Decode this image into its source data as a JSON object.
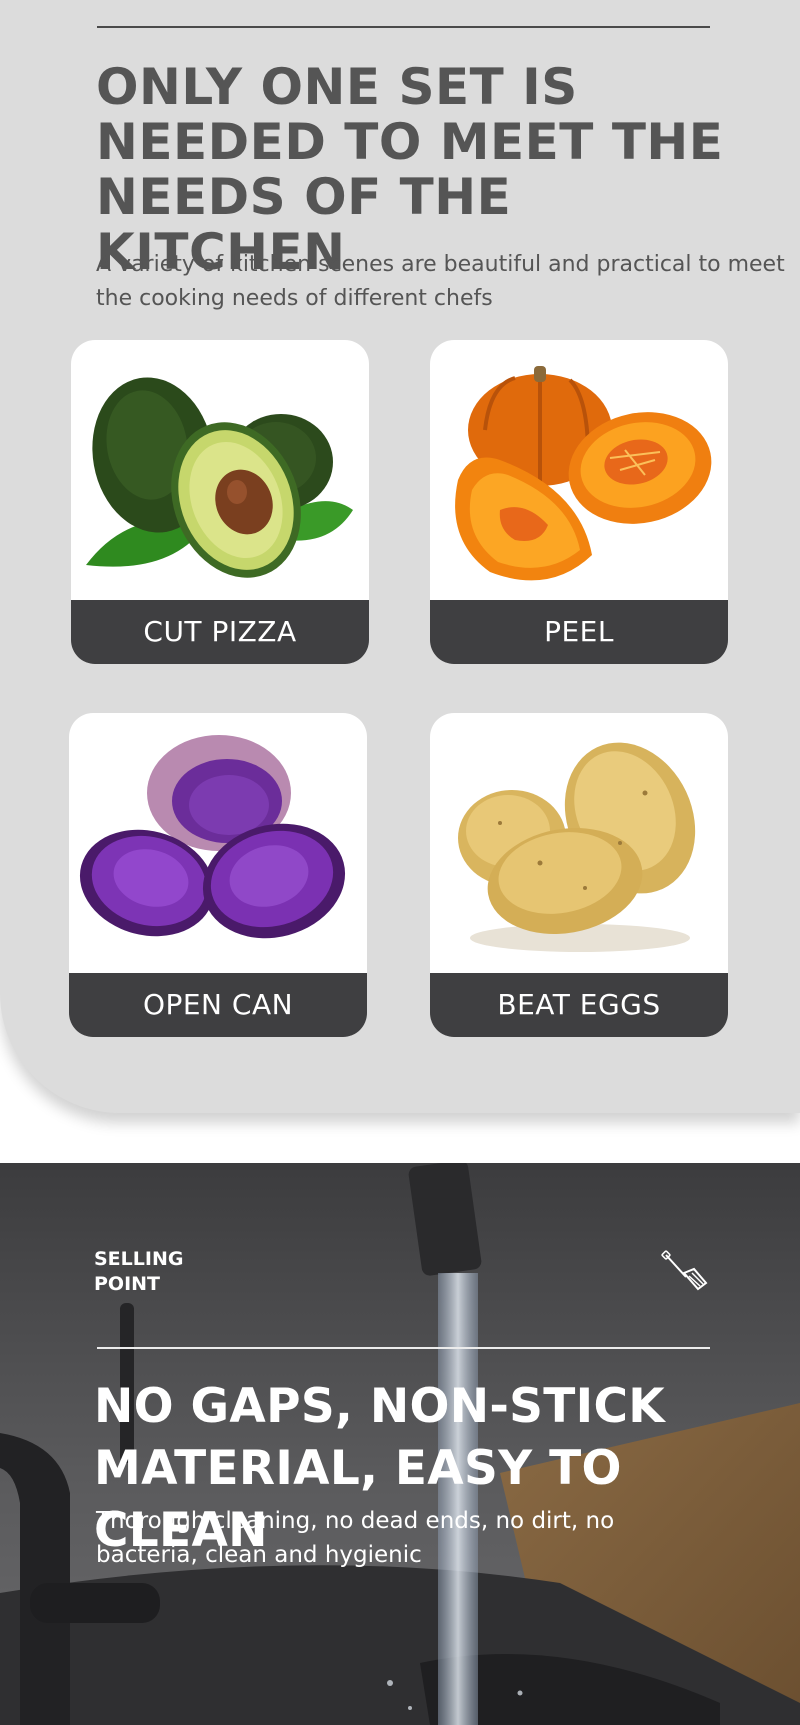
{
  "intro": {
    "headline": "ONLY ONE SET IS NEEDED TO MEET THE NEEDS OF THE KITCHEN",
    "subtitle": "A variety of kitchen scenes are beautiful and practical to meet the cooking needs of different chefs"
  },
  "cards": [
    {
      "label": "CUT PIZZA",
      "image": "avocado"
    },
    {
      "label": "PEEL",
      "image": "pumpkin"
    },
    {
      "label": "OPEN CAN",
      "image": "purple-sweet-potato"
    },
    {
      "label": "BEAT EGGS",
      "image": "potatoes"
    }
  ],
  "selling": {
    "tag": "SELLING\nPOINT",
    "icon": "spatula-icon",
    "headline": "NO GAPS, NON-STICK MATERIAL, EASY TO CLEAN",
    "text": "Thorough cleaning, no dead ends, no dirt, no bacteria, clean and hygienic"
  },
  "colors": {
    "panel": "#dcdcdc",
    "heading_text": "#555555",
    "label_bar": "#3f3f41",
    "dark_section": "#3a3a3c"
  }
}
